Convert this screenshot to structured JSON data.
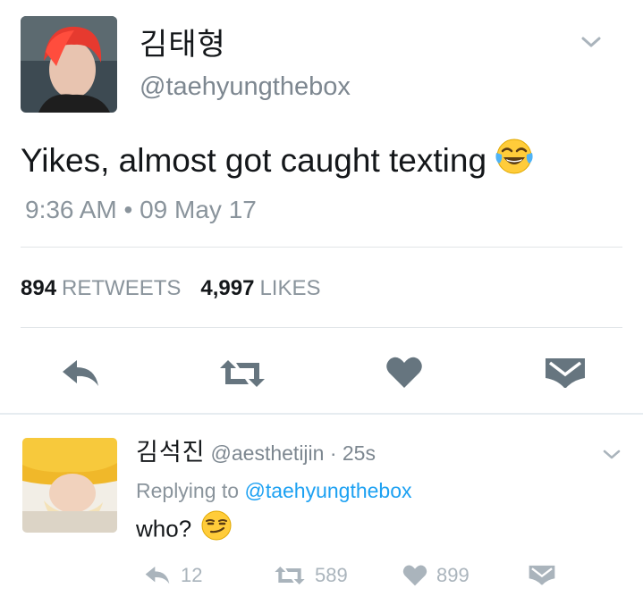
{
  "main_tweet": {
    "display_name": "김태형",
    "handle": "@taehyungthebox",
    "text": "Yikes, almost got caught texting",
    "emoji_icon": "face-with-tears-of-joy-icon",
    "timestamp": "9:36 AM • 09 May 17",
    "retweets_count": "894",
    "retweets_label": "RETWEETS",
    "likes_count": "4,997",
    "likes_label": "LIKES",
    "actions": [
      "reply-icon",
      "retweet-icon",
      "like-icon",
      "message-icon"
    ]
  },
  "reply": {
    "display_name": "김석진",
    "handle": "@aesthetijin · 25s",
    "replying_prefix": "Replying to",
    "replying_to": "@taehyungthebox",
    "text": "who?",
    "emoji_icon": "smirking-face-icon",
    "reply_count": "12",
    "retweet_count": "589",
    "like_count": "899"
  },
  "colors": {
    "text_primary": "#14171a",
    "text_secondary": "#8a949c",
    "icon_main": "#66757f",
    "icon_reply": "#aab4bc",
    "link": "#1da1f2",
    "divider": "#e1e5e8"
  }
}
